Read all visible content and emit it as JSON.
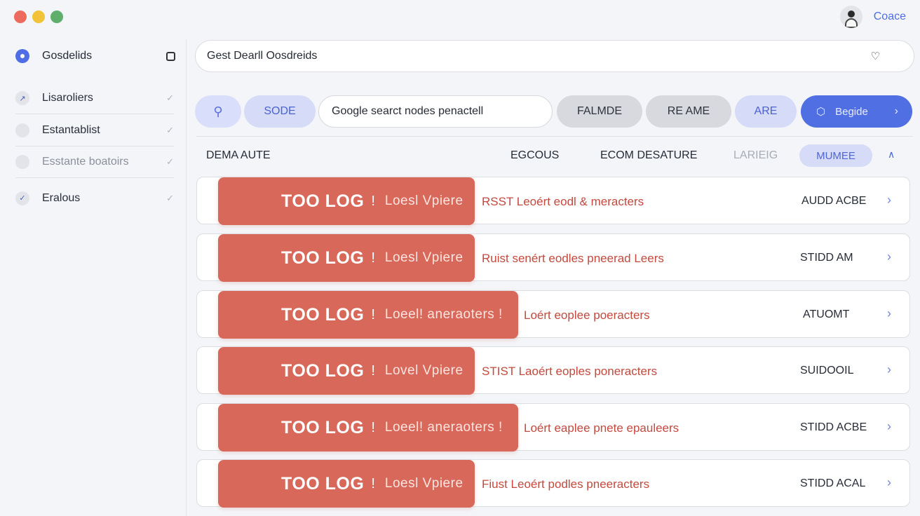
{
  "window": {
    "user_name": "Coace"
  },
  "sidebar": {
    "title": "Gosdelids",
    "items": [
      {
        "label": "Lisaroliers",
        "icon": "trend-icon",
        "muted": false
      },
      {
        "label": "Estantablist",
        "icon": "dot-icon",
        "muted": false
      },
      {
        "label": "Esstante boatoirs",
        "icon": "dot-icon",
        "muted": true
      },
      {
        "label": "Eralous",
        "icon": "check-icon",
        "muted": false
      }
    ]
  },
  "search": {
    "value": "Gest Dearll Oosdreids"
  },
  "toolbar": {
    "sode_label": "SODE",
    "input_value": "Google searct nodes penactell",
    "falmde_label": "FALMDE",
    "rename_label": "RE AME",
    "are_label": "ARE",
    "begin_label": "Begide"
  },
  "columns": {
    "c1": "DEMA AUTE",
    "c2": "EGCOUS",
    "c3": "ECOM DESATURE",
    "c4": "LARIEIG",
    "badge": "MUMEE"
  },
  "rows": [
    {
      "tag": "TOO LOG",
      "bang": "!",
      "sub": "Loesl Vpiere",
      "desc": "RSST Leoért eodl & meracters",
      "status": "AUDD ACBE"
    },
    {
      "tag": "TOO LOG",
      "bang": "!",
      "sub": "Loesl Vpiere",
      "desc": "Ruist senért eodles pnеerad Leers",
      "status": "STIDD AM"
    },
    {
      "tag": "TOO LOG",
      "bang": "!",
      "sub": "Loeel! anеraoters !",
      "desc": "Loért eoplee poeracters",
      "status": "ATUOMT"
    },
    {
      "tag": "TOO LOG",
      "bang": "!",
      "sub": "Lovel Vpiere",
      "desc": "STIST Laoért eoples poneracters",
      "status": "SUIDOOIL"
    },
    {
      "tag": "TOO LOG",
      "bang": "!",
      "sub": "Loeel! aneraoters !",
      "desc": "Loért eaplee pnete epaulеers",
      "status": "STIDD ACBE"
    },
    {
      "tag": "TOO LOG",
      "bang": "!",
      "sub": "Loesl Vpiere",
      "desc": "Fiust Leoért podles pneeracters",
      "status": "STIDD ACAL"
    }
  ]
}
